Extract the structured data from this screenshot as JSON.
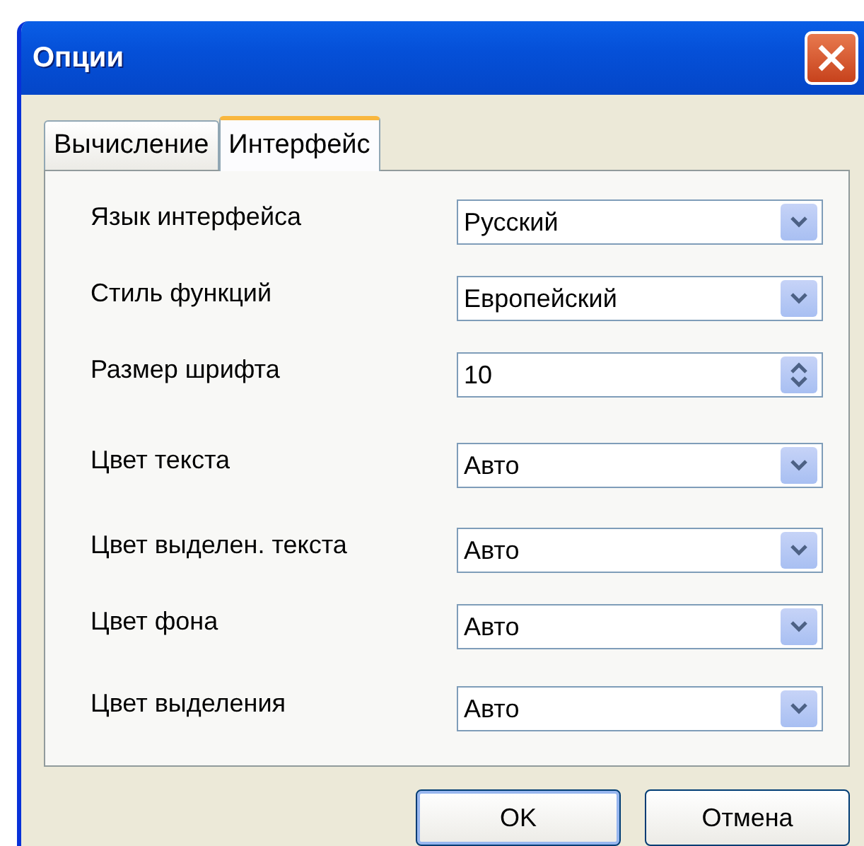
{
  "window": {
    "title": "Опции"
  },
  "tabs": [
    {
      "label": "Вычисление",
      "selected": false
    },
    {
      "label": "Интерфейс",
      "selected": true
    }
  ],
  "fields": [
    {
      "label": "Язык интерфейса",
      "value": "Русский",
      "kind": "dropdown"
    },
    {
      "label": "Стиль функций",
      "value": "Европейский",
      "kind": "dropdown"
    },
    {
      "label": "Размер шрифта",
      "value": "10",
      "kind": "spinner"
    },
    {
      "label": "Цвет текста",
      "value": "Авто",
      "kind": "dropdown"
    },
    {
      "label": "Цвет выделен. текста",
      "value": "Авто",
      "kind": "dropdown"
    },
    {
      "label": "Цвет фона",
      "value": "Авто",
      "kind": "dropdown"
    },
    {
      "label": "Цвет выделения",
      "value": "Авто",
      "kind": "dropdown"
    }
  ],
  "buttons": [
    {
      "label": "OK",
      "kind": "default"
    },
    {
      "label": "Отмена",
      "kind": "normal"
    }
  ]
}
